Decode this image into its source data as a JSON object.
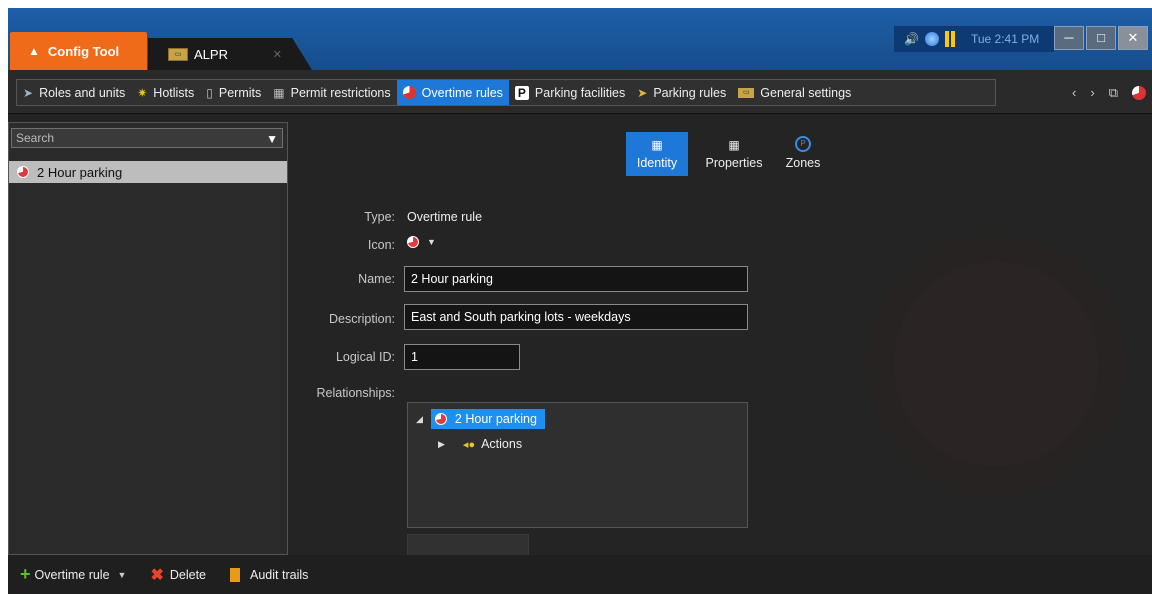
{
  "titlebar": {
    "active_tab": "Config Tool",
    "second_tab": "ALPR",
    "clock": "Tue 2:41 PM"
  },
  "nav": {
    "items": [
      {
        "label": "Roles and units",
        "icon": "roles-icon"
      },
      {
        "label": "Hotlists",
        "icon": "hotlist-icon"
      },
      {
        "label": "Permits",
        "icon": "permit-icon"
      },
      {
        "label": "Permit restrictions",
        "icon": "permit-restriction-icon"
      },
      {
        "label": "Overtime rules",
        "icon": "overtime-rule-icon",
        "active": true
      },
      {
        "label": "Parking facilities",
        "icon": "parking-icon"
      },
      {
        "label": "Parking rules",
        "icon": "parking-rule-icon"
      },
      {
        "label": "General settings",
        "icon": "alpr-icon"
      }
    ],
    "back": "‹",
    "forward": "›"
  },
  "left": {
    "search_placeholder": "Search",
    "items": [
      {
        "label": "2 Hour parking",
        "selected": true
      }
    ]
  },
  "tabs": [
    {
      "label": "Identity",
      "active": true
    },
    {
      "label": "Properties"
    },
    {
      "label": "Zones"
    }
  ],
  "form": {
    "type_label": "Type:",
    "type_value": "Overtime rule",
    "icon_label": "Icon:",
    "name_label": "Name:",
    "name_value": "2 Hour parking",
    "description_label": "Description:",
    "description_value": "East and South parking lots - weekdays",
    "logical_id_label": "Logical ID:",
    "logical_id_value": "1",
    "relationships_label": "Relationships:",
    "tree": {
      "root": "2 Hour parking",
      "child": "Actions"
    }
  },
  "bottom": {
    "add_label": "Overtime rule",
    "delete_label": "Delete",
    "audit_label": "Audit trails"
  },
  "colors": {
    "accent": "#1e78d7",
    "brand": "#ef6b1a",
    "titlebar": "#1d5fa8"
  }
}
